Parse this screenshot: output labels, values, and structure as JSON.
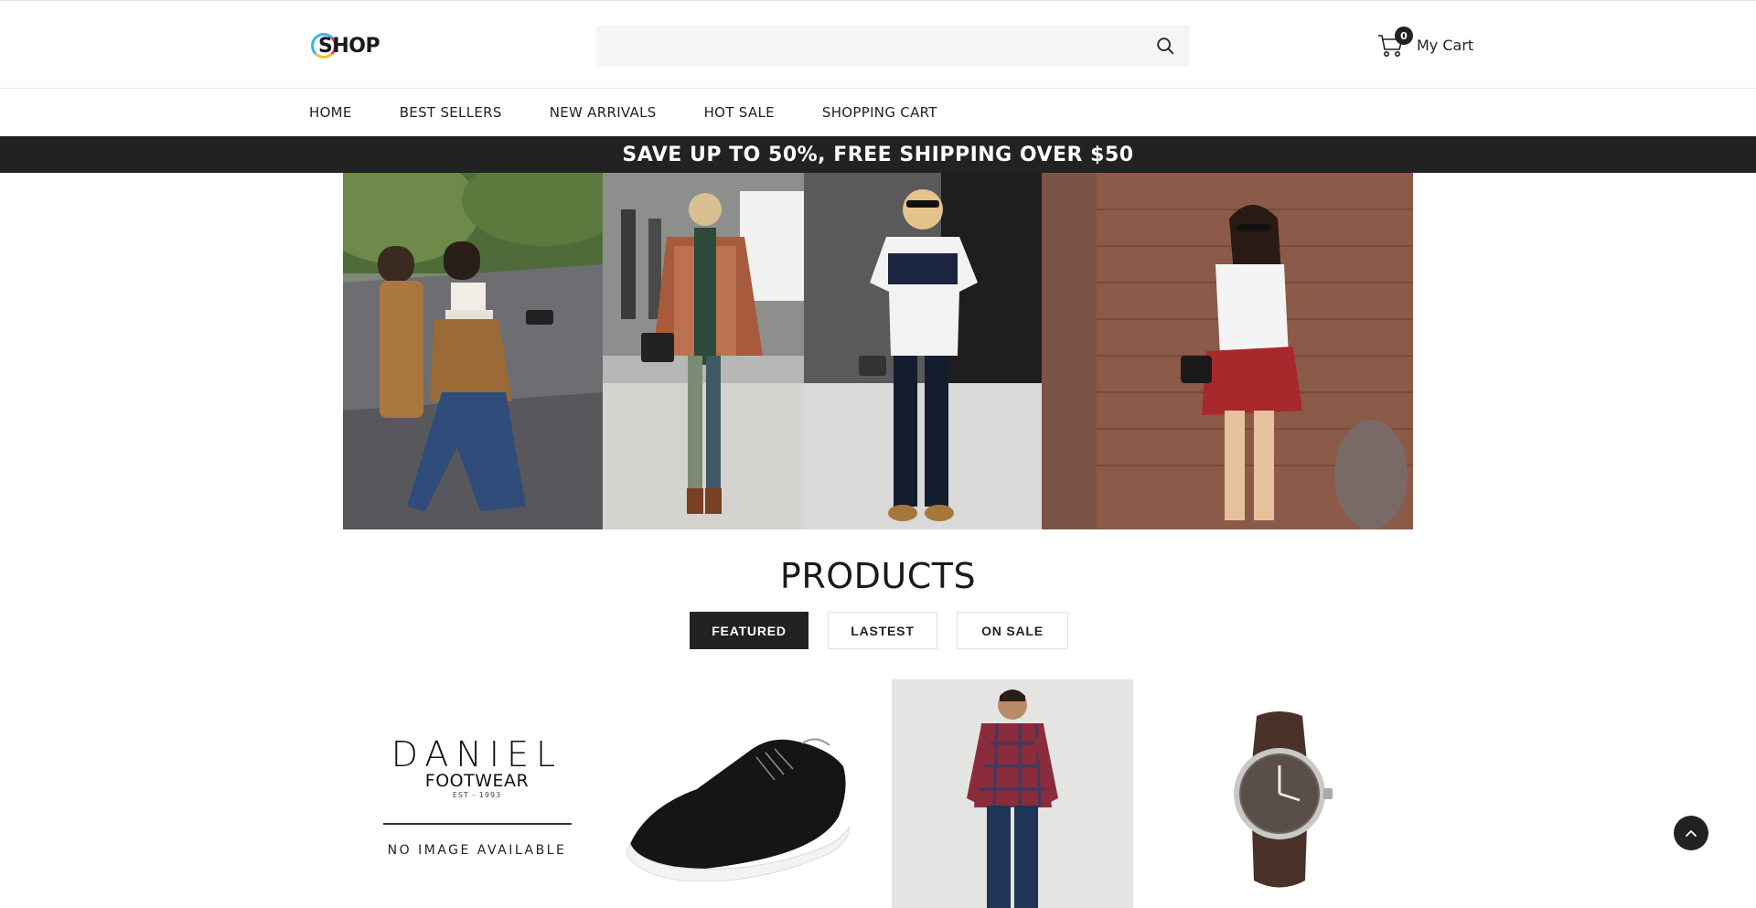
{
  "header": {
    "logo_text": "SHOP",
    "search": {
      "value": "",
      "placeholder": ""
    },
    "cart": {
      "count": "0",
      "label": "My Cart"
    }
  },
  "nav": {
    "items": [
      {
        "label": "HOME"
      },
      {
        "label": "BEST SELLERS"
      },
      {
        "label": "NEW ARRIVALS"
      },
      {
        "label": "HOT SALE"
      },
      {
        "label": "SHOPPING CART"
      }
    ]
  },
  "promo": {
    "text": "SAVE UP TO 50%, FREE SHIPPING OVER $50"
  },
  "products": {
    "title": "PRODUCTS",
    "tabs": [
      {
        "label": "FEATURED",
        "active": true
      },
      {
        "label": "LASTEST",
        "active": false
      },
      {
        "label": "ON SALE",
        "active": false
      }
    ],
    "items": [
      {
        "brand_line1": "DANIEL",
        "brand_line2": "FOOTWEAR",
        "brand_line3": "EST - 1993",
        "placeholder_text": "NO IMAGE AVAILABLE"
      },
      {
        "image": "black-sneaker"
      },
      {
        "image": "man-plaid-shirt"
      },
      {
        "image": "wrist-watch"
      }
    ]
  },
  "colors": {
    "dark": "#222222",
    "search_bg": "#f5f5f5"
  }
}
